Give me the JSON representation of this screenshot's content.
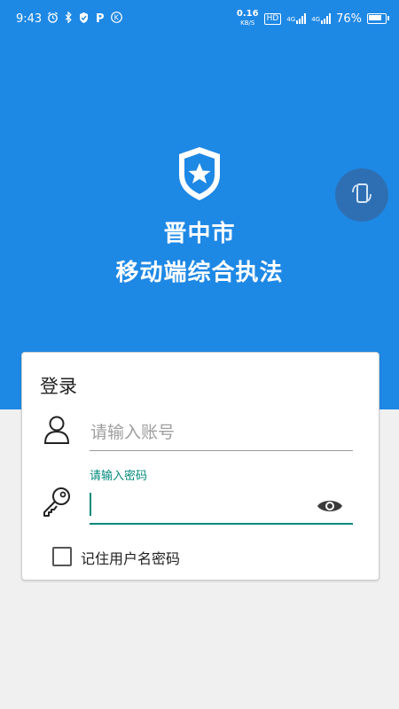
{
  "status_bar": {
    "time": "9:43",
    "speed_value": "0.16",
    "speed_unit": "KB/S",
    "hd": "HD",
    "net1": "4G",
    "net2": "4G",
    "battery": "76%",
    "left_icons": [
      "alarm-icon",
      "bluetooth-icon",
      "shield-check-icon",
      "p-app-icon",
      "k-app-icon"
    ]
  },
  "hero": {
    "title_line1": "晋中市",
    "title_line2": "移动端综合执法",
    "accent_color": "#1e88e5"
  },
  "login": {
    "heading": "登录",
    "account_placeholder": "请输入账号",
    "password_label": "请输入密码",
    "password_value": "",
    "remember_label": "记住用户名密码",
    "remember_checked": false,
    "focus_color": "#00897b"
  }
}
